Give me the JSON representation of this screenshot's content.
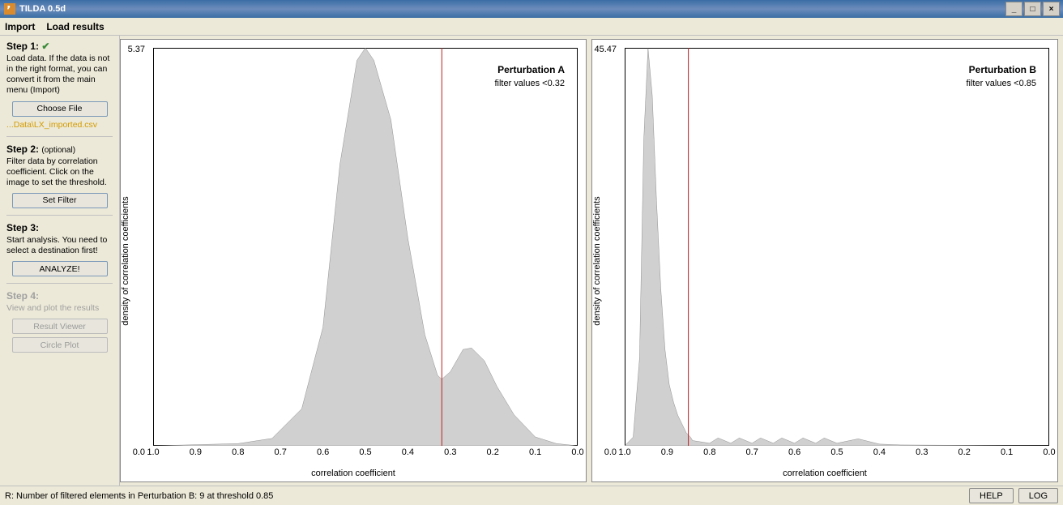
{
  "window": {
    "title": "TILDA 0.5d"
  },
  "menu": {
    "import": "Import",
    "load_results": "Load results"
  },
  "sidebar": {
    "step1": {
      "title": "Step 1:",
      "check": "✔",
      "desc": "Load data. If the data is not in the right format, you can convert it from the main menu (Import)",
      "button": "Choose File",
      "file": "...Data\\LX_imported.csv"
    },
    "step2": {
      "title": "Step 2:",
      "optional": "(optional)",
      "desc": "Filter data by correlation coefficient. Click on the image to set the threshold.",
      "button": "Set Filter"
    },
    "step3": {
      "title": "Step 3:",
      "desc": "Start analysis. You need to select a destination first!",
      "button": "ANALYZE!"
    },
    "step4": {
      "title": "Step 4:",
      "desc": "View and plot the results",
      "button1": "Result Viewer",
      "button2": "Circle Plot"
    }
  },
  "plots": {
    "ylab": "density of correlation coefficients",
    "xlab": "correlation coefficient",
    "xticks": [
      "1.0",
      "0.9",
      "0.8",
      "0.7",
      "0.6",
      "0.5",
      "0.4",
      "0.3",
      "0.2",
      "0.1",
      "0.0"
    ],
    "A": {
      "label": "Perturbation A",
      "filter": "filter values <0.32",
      "ymax": "5.37",
      "ymin": "0.0"
    },
    "B": {
      "label": "Perturbation B",
      "filter": "filter values <0.85",
      "ymax": "45.47",
      "ymin": "0.0"
    }
  },
  "status": {
    "text": "R: Number of filtered elements in Perturbation B: 9 at threshold 0.85",
    "help": "HELP",
    "log": "LOG"
  },
  "chart_data": [
    {
      "type": "area",
      "name": "Perturbation A",
      "xlabel": "correlation coefficient",
      "ylabel": "density of correlation coefficients",
      "xlim": [
        1.0,
        0.0
      ],
      "ylim": [
        0.0,
        5.37
      ],
      "threshold_x": 0.32,
      "x": [
        1.0,
        0.8,
        0.72,
        0.65,
        0.6,
        0.56,
        0.52,
        0.5,
        0.48,
        0.44,
        0.4,
        0.36,
        0.33,
        0.32,
        0.3,
        0.27,
        0.25,
        0.22,
        0.19,
        0.15,
        0.1,
        0.05,
        0.0
      ],
      "y": [
        0.0,
        0.03,
        0.1,
        0.5,
        1.6,
        3.8,
        5.2,
        5.37,
        5.2,
        4.4,
        2.8,
        1.5,
        0.95,
        0.9,
        1.0,
        1.3,
        1.32,
        1.15,
        0.8,
        0.42,
        0.12,
        0.03,
        0.0
      ]
    },
    {
      "type": "area",
      "name": "Perturbation B",
      "xlabel": "correlation coefficient",
      "ylabel": "density of correlation coefficients",
      "xlim": [
        1.0,
        0.0
      ],
      "ylim": [
        0.0,
        45.47
      ],
      "threshold_x": 0.85,
      "x": [
        1.0,
        0.98,
        0.965,
        0.955,
        0.945,
        0.935,
        0.925,
        0.915,
        0.905,
        0.895,
        0.885,
        0.875,
        0.865,
        0.855,
        0.845,
        0.84,
        0.8,
        0.78,
        0.75,
        0.73,
        0.7,
        0.68,
        0.65,
        0.63,
        0.6,
        0.58,
        0.55,
        0.53,
        0.5,
        0.45,
        0.4,
        0.35,
        0.0
      ],
      "y": [
        0.0,
        1.0,
        10.0,
        35.0,
        45.47,
        40.0,
        28.0,
        18.0,
        11.0,
        7.0,
        5.0,
        3.5,
        2.5,
        1.5,
        1.0,
        0.6,
        0.3,
        0.9,
        0.3,
        0.9,
        0.3,
        0.9,
        0.3,
        0.9,
        0.3,
        0.9,
        0.3,
        0.9,
        0.3,
        0.8,
        0.2,
        0.1,
        0.0
      ]
    }
  ]
}
